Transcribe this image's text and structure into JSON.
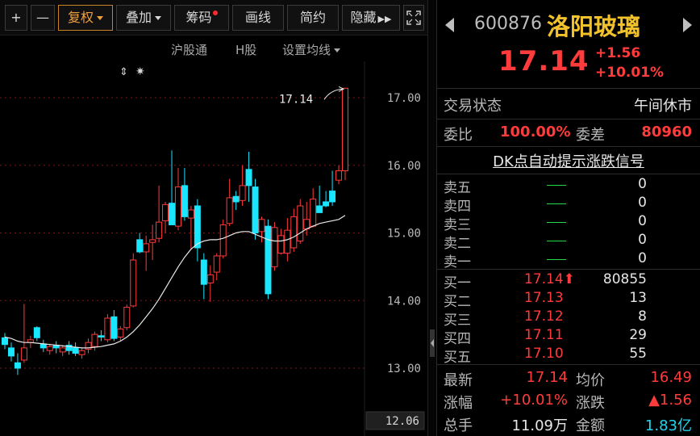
{
  "toolbar": {
    "plus_label": "+",
    "minus_label": "—",
    "restore_rights_label": "复权",
    "overlay_label": "叠加",
    "chips_label": "筹码",
    "draw_label": "画线",
    "simple_label": "简约",
    "hide_label": "隐藏"
  },
  "subbar": {
    "hk_connect_label": "沪股通",
    "h_share_label": "H股",
    "ma_settings_label": "设置均线"
  },
  "chart": {
    "last_price_label": "17.14",
    "bottom_readout": "12.06",
    "colors": {
      "up": "#ff3b3b",
      "down": "#19e6ff",
      "ma": "#e8e8e8",
      "grid": "#7a1616"
    }
  },
  "chart_data": {
    "type": "candlestick",
    "y_ticks": [
      "17.00",
      "16.00",
      "15.00",
      "14.00",
      "13.00"
    ],
    "ylim": [
      12.06,
      17.3
    ],
    "candles": [
      {
        "o": 13.45,
        "h": 13.52,
        "l": 13.28,
        "c": 13.35
      },
      {
        "o": 13.3,
        "h": 13.38,
        "l": 13.1,
        "c": 13.18
      },
      {
        "o": 13.08,
        "h": 13.22,
        "l": 12.9,
        "c": 13.0
      },
      {
        "o": 13.12,
        "h": 13.95,
        "l": 13.08,
        "c": 13.3
      },
      {
        "o": 13.38,
        "h": 13.48,
        "l": 13.3,
        "c": 13.42
      },
      {
        "o": 13.6,
        "h": 13.62,
        "l": 13.4,
        "c": 13.45
      },
      {
        "o": 13.36,
        "h": 13.42,
        "l": 13.24,
        "c": 13.3
      },
      {
        "o": 13.26,
        "h": 13.36,
        "l": 13.2,
        "c": 13.32
      },
      {
        "o": 13.34,
        "h": 13.4,
        "l": 13.22,
        "c": 13.3
      },
      {
        "o": 13.24,
        "h": 13.34,
        "l": 13.18,
        "c": 13.3
      },
      {
        "o": 13.34,
        "h": 13.4,
        "l": 13.2,
        "c": 13.26
      },
      {
        "o": 13.3,
        "h": 13.38,
        "l": 13.18,
        "c": 13.22
      },
      {
        "o": 13.2,
        "h": 13.3,
        "l": 13.14,
        "c": 13.26
      },
      {
        "o": 13.28,
        "h": 13.44,
        "l": 13.22,
        "c": 13.38
      },
      {
        "o": 13.32,
        "h": 13.54,
        "l": 13.26,
        "c": 13.5
      },
      {
        "o": 13.48,
        "h": 13.56,
        "l": 13.4,
        "c": 13.46
      },
      {
        "o": 13.42,
        "h": 13.8,
        "l": 13.38,
        "c": 13.74
      },
      {
        "o": 13.76,
        "h": 13.86,
        "l": 13.4,
        "c": 13.44
      },
      {
        "o": 13.46,
        "h": 13.62,
        "l": 13.4,
        "c": 13.58
      },
      {
        "o": 13.6,
        "h": 13.94,
        "l": 13.56,
        "c": 13.9
      },
      {
        "o": 13.92,
        "h": 14.7,
        "l": 13.9,
        "c": 14.6
      },
      {
        "o": 14.9,
        "h": 15.0,
        "l": 14.7,
        "c": 14.72
      },
      {
        "o": 14.72,
        "h": 14.96,
        "l": 14.44,
        "c": 14.84
      },
      {
        "o": 14.86,
        "h": 15.12,
        "l": 14.6,
        "c": 14.9
      },
      {
        "o": 14.92,
        "h": 15.7,
        "l": 14.86,
        "c": 15.16
      },
      {
        "o": 15.18,
        "h": 15.46,
        "l": 15.0,
        "c": 15.42
      },
      {
        "o": 15.44,
        "h": 16.22,
        "l": 15.38,
        "c": 15.12
      },
      {
        "o": 15.1,
        "h": 15.96,
        "l": 15.04,
        "c": 15.68
      },
      {
        "o": 15.7,
        "h": 15.96,
        "l": 15.18,
        "c": 15.24
      },
      {
        "o": 15.22,
        "h": 15.4,
        "l": 14.76,
        "c": 15.34
      },
      {
        "o": 15.4,
        "h": 15.5,
        "l": 14.58,
        "c": 14.78
      },
      {
        "o": 14.6,
        "h": 14.7,
        "l": 14.02,
        "c": 14.24
      },
      {
        "o": 14.26,
        "h": 14.52,
        "l": 13.98,
        "c": 14.38
      },
      {
        "o": 14.42,
        "h": 14.7,
        "l": 14.3,
        "c": 14.66
      },
      {
        "o": 14.66,
        "h": 15.2,
        "l": 14.62,
        "c": 15.12
      },
      {
        "o": 15.14,
        "h": 15.8,
        "l": 15.1,
        "c": 15.52
      },
      {
        "o": 15.54,
        "h": 15.62,
        "l": 15.34,
        "c": 15.46
      },
      {
        "o": 15.48,
        "h": 16.0,
        "l": 15.4,
        "c": 15.7
      },
      {
        "o": 15.94,
        "h": 16.2,
        "l": 15.46,
        "c": 15.7
      },
      {
        "o": 15.68,
        "h": 15.8,
        "l": 14.9,
        "c": 15.0
      },
      {
        "o": 15.02,
        "h": 15.24,
        "l": 14.86,
        "c": 15.2
      },
      {
        "o": 15.1,
        "h": 15.2,
        "l": 14.02,
        "c": 14.1
      },
      {
        "o": 14.5,
        "h": 15.16,
        "l": 14.44,
        "c": 15.08
      },
      {
        "o": 14.7,
        "h": 15.06,
        "l": 14.68,
        "c": 14.96
      },
      {
        "o": 14.7,
        "h": 15.22,
        "l": 14.58,
        "c": 15.04
      },
      {
        "o": 14.78,
        "h": 15.36,
        "l": 14.72,
        "c": 15.24
      },
      {
        "o": 14.88,
        "h": 15.5,
        "l": 14.84,
        "c": 15.4
      },
      {
        "o": 15.06,
        "h": 15.46,
        "l": 14.96,
        "c": 15.2
      },
      {
        "o": 15.1,
        "h": 15.66,
        "l": 15.08,
        "c": 15.5
      },
      {
        "o": 15.4,
        "h": 15.7,
        "l": 15.3,
        "c": 15.3
      },
      {
        "o": 15.46,
        "h": 15.62,
        "l": 15.38,
        "c": 15.4
      },
      {
        "o": 15.62,
        "h": 15.92,
        "l": 15.4,
        "c": 15.46
      },
      {
        "o": 15.78,
        "h": 16.0,
        "l": 15.72,
        "c": 15.92
      },
      {
        "o": 15.92,
        "h": 17.14,
        "l": 15.78,
        "c": 17.14
      }
    ],
    "ma": [
      13.46,
      13.44,
      13.4,
      13.38,
      13.38,
      13.37,
      13.36,
      13.35,
      13.34,
      13.33,
      13.32,
      13.31,
      13.3,
      13.3,
      13.31,
      13.32,
      13.34,
      13.36,
      13.4,
      13.46,
      13.54,
      13.64,
      13.76,
      13.88,
      14.02,
      14.18,
      14.34,
      14.5,
      14.64,
      14.76,
      14.84,
      14.88,
      14.9,
      14.9,
      14.92,
      14.96,
      15.0,
      15.02,
      15.02,
      14.98,
      14.94,
      14.9,
      14.88,
      14.88,
      14.9,
      14.94,
      15.0,
      15.06,
      15.1,
      15.14,
      15.16,
      15.18,
      15.2,
      15.26
    ]
  },
  "quote": {
    "code": "600876",
    "name": "洛阳玻璃",
    "price": "17.14",
    "change": "+1.56",
    "change_pct": "+10.01%",
    "trade_status_label": "交易状态",
    "trade_status_value": "午间休市",
    "bid_ratio_label": "委比",
    "bid_ratio_value": "100.00%",
    "bid_diff_label": "委差",
    "bid_diff_value": "80960",
    "dk_signal_label": "DK点自动提示涨跌信号",
    "asks": [
      {
        "label": "卖五",
        "price": "",
        "vol": "0"
      },
      {
        "label": "卖四",
        "price": "",
        "vol": "0"
      },
      {
        "label": "卖三",
        "price": "",
        "vol": "0"
      },
      {
        "label": "卖二",
        "price": "",
        "vol": "0"
      },
      {
        "label": "卖一",
        "price": "",
        "vol": "0"
      }
    ],
    "bids": [
      {
        "label": "买一",
        "price": "17.14",
        "vol": "80855"
      },
      {
        "label": "买二",
        "price": "17.13",
        "vol": "13"
      },
      {
        "label": "买三",
        "price": "17.12",
        "vol": "8"
      },
      {
        "label": "买四",
        "price": "17.11",
        "vol": "29"
      },
      {
        "label": "买五",
        "price": "17.10",
        "vol": "55"
      }
    ],
    "stats": {
      "latest_label": "最新",
      "latest_value": "17.14",
      "avg_label": "均价",
      "avg_value": "16.49",
      "chg_pct_label": "涨幅",
      "chg_pct_value": "+10.01%",
      "chg_label": "涨跌",
      "chg_value": "▲1.56",
      "volume_label": "总手",
      "volume_value": "11.09万",
      "amount_label": "金额",
      "amount_value": "1.83亿"
    }
  }
}
